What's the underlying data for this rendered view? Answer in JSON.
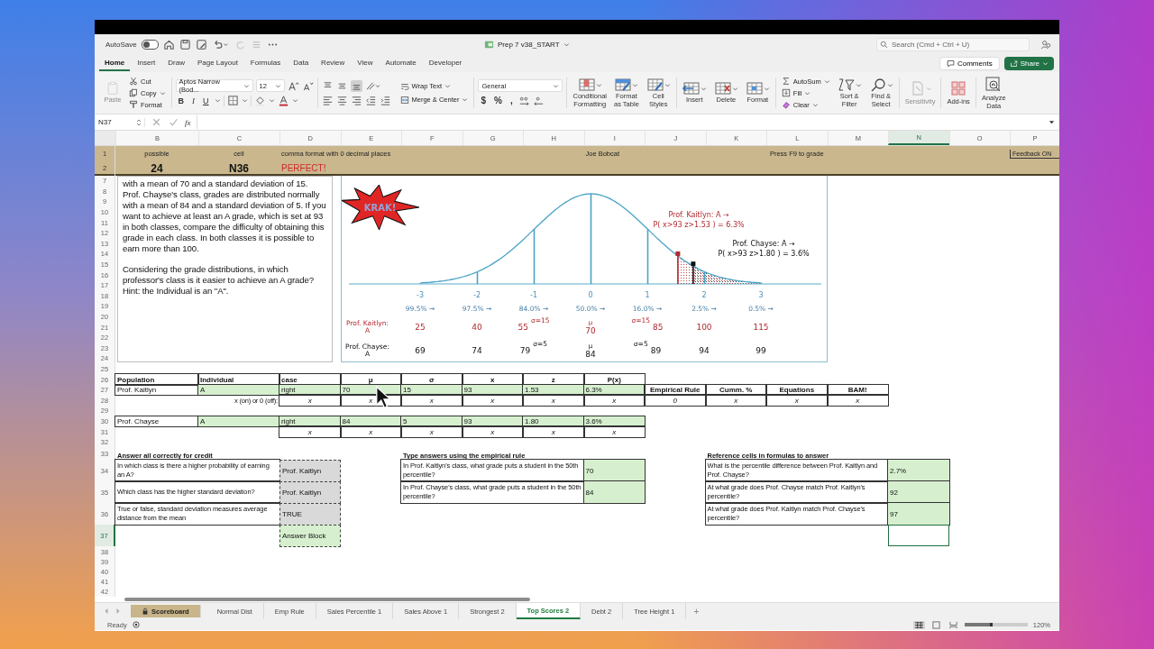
{
  "title_bar": {
    "autosave_label": "AutoSave",
    "autosave_on": false,
    "file_name": "Prep 7 v38_START",
    "search_placeholder": "Search (Cmd + Ctrl + U)"
  },
  "ribbon_tabs": [
    {
      "label": "Home",
      "selected": true
    },
    {
      "label": "Insert",
      "selected": false
    },
    {
      "label": "Draw",
      "selected": false
    },
    {
      "label": "Page Layout",
      "selected": false
    },
    {
      "label": "Formulas",
      "selected": false
    },
    {
      "label": "Data",
      "selected": false
    },
    {
      "label": "Review",
      "selected": false
    },
    {
      "label": "View",
      "selected": false
    },
    {
      "label": "Automate",
      "selected": false
    },
    {
      "label": "Developer",
      "selected": false
    }
  ],
  "comments_button": "Comments",
  "share_button": "Share",
  "ribbon": {
    "paste": {
      "label": "Paste",
      "disabled": true
    },
    "clipboard_items": [
      {
        "kind": "cut",
        "label": "Cut",
        "dropdown": false
      },
      {
        "kind": "copy",
        "label": "Copy",
        "dropdown": true
      },
      {
        "kind": "painter",
        "label": "Format",
        "dropdown": false
      }
    ],
    "font_name": "Aptos Narrow (Bod...",
    "font_size": "12",
    "style_buttons": [
      {
        "kind": "bold",
        "label": "B"
      },
      {
        "kind": "italic",
        "label": "I"
      },
      {
        "kind": "underline",
        "label": "U"
      }
    ],
    "vertical_align": [
      {
        "kind": "top",
        "selected": false
      },
      {
        "kind": "middle",
        "selected": false
      },
      {
        "kind": "bottom",
        "selected": true
      }
    ],
    "wrap_text": "Wrap Text",
    "merge_center": "Merge & Center",
    "number_format": "General",
    "number_symbols": [
      "$",
      "%",
      ","
    ],
    "styles_buttons": [
      {
        "kind": "conditional",
        "label": "Conditional\nFormatting",
        "dropdown": true,
        "disabled": false
      },
      {
        "kind": "table",
        "label": "Format\nas Table",
        "dropdown": true,
        "disabled": false
      },
      {
        "kind": "cellstyles",
        "label": "Cell\nStyles",
        "dropdown": true,
        "disabled": false
      }
    ],
    "cells_buttons": [
      {
        "kind": "insert",
        "label": "Insert",
        "dropdown": true,
        "disabled": false
      },
      {
        "kind": "delete",
        "label": "Delete",
        "dropdown": true,
        "disabled": false
      },
      {
        "kind": "format",
        "label": "Format",
        "dropdown": true,
        "disabled": false
      }
    ],
    "editing_items": [
      {
        "kind": "sum",
        "label": "AutoSum"
      },
      {
        "kind": "fill",
        "label": "Fill"
      },
      {
        "kind": "clear",
        "label": "Clear"
      }
    ],
    "editing_buttons": [
      {
        "kind": "sort",
        "label": "Sort &\nFilter",
        "dropdown": true,
        "disabled": false
      },
      {
        "kind": "find",
        "label": "Find &\nSelect",
        "dropdown": true,
        "disabled": false
      }
    ],
    "extra_buttons": [
      {
        "kind": "sensitivity",
        "label": "Sensitivity",
        "dropdown": true,
        "disabled": true
      },
      {
        "kind": "addins",
        "label": "Add-ins",
        "dropdown": false,
        "disabled": false
      },
      {
        "kind": "analyze",
        "label": "Analyze\nData",
        "dropdown": false,
        "disabled": false
      }
    ]
  },
  "formula_bar": {
    "name_box": "N37",
    "function_label": "fx"
  },
  "column_headers": [
    {
      "label": "B",
      "selected": false
    },
    {
      "label": "C",
      "selected": false
    },
    {
      "label": "D",
      "selected": false
    },
    {
      "label": "E",
      "selected": false
    },
    {
      "label": "F",
      "selected": false
    },
    {
      "label": "G",
      "selected": false
    },
    {
      "label": "H",
      "selected": false
    },
    {
      "label": "I",
      "selected": false
    },
    {
      "label": "J",
      "selected": false
    },
    {
      "label": "K",
      "selected": false
    },
    {
      "label": "L",
      "selected": false
    },
    {
      "label": "M",
      "selected": false
    },
    {
      "label": "N",
      "selected": true
    },
    {
      "label": "O",
      "selected": false
    },
    {
      "label": "P",
      "selected": false
    }
  ],
  "row_headers": [
    {
      "label": "1",
      "selected": false
    },
    {
      "label": "2",
      "selected": false
    },
    {
      "label": "7",
      "selected": false
    },
    {
      "label": "8",
      "selected": false
    },
    {
      "label": "9",
      "selected": false
    },
    {
      "label": "10",
      "selected": false
    },
    {
      "label": "11",
      "selected": false
    },
    {
      "label": "12",
      "selected": false
    },
    {
      "label": "13",
      "selected": false
    },
    {
      "label": "14",
      "selected": false
    },
    {
      "label": "15",
      "selected": false
    },
    {
      "label": "16",
      "selected": false
    },
    {
      "label": "17",
      "selected": false
    },
    {
      "label": "18",
      "selected": false
    },
    {
      "label": "19",
      "selected": false
    },
    {
      "label": "20",
      "selected": false
    },
    {
      "label": "21",
      "selected": false
    },
    {
      "label": "22",
      "selected": false
    },
    {
      "label": "23",
      "selected": false
    },
    {
      "label": "24",
      "selected": false
    },
    {
      "label": "25",
      "selected": false
    },
    {
      "label": "26",
      "selected": false
    },
    {
      "label": "27",
      "selected": false
    },
    {
      "label": "28",
      "selected": false
    },
    {
      "label": "29",
      "selected": false
    },
    {
      "label": "30",
      "selected": false
    },
    {
      "label": "31",
      "selected": false
    },
    {
      "label": "32",
      "selected": false
    },
    {
      "label": "33",
      "selected": false
    },
    {
      "label": "34",
      "selected": false
    },
    {
      "label": "35",
      "selected": false
    },
    {
      "label": "36",
      "selected": false
    },
    {
      "label": "37",
      "selected": true
    },
    {
      "label": "38",
      "selected": false
    },
    {
      "label": "39",
      "selected": false
    },
    {
      "label": "40",
      "selected": false
    },
    {
      "label": "41",
      "selected": false
    },
    {
      "label": "42",
      "selected": false
    }
  ],
  "banner": {
    "possible_label": "possible",
    "possible_value": "24",
    "cell_label": "cell",
    "cell_value": "N36",
    "note": "comma format with 0 decimal places",
    "status": "PERFECT!",
    "student": "Joe Bobcat",
    "instruction": "Press F9 to grade",
    "feedback": "Feedback ON"
  },
  "problem_text": [
    "with a mean of 70 and a standard deviation of 15. Prof. Chayse's class, grades are distributed normally with a mean of 84 and a standard deviation of 5. If you want to achieve at least an A grade, which is set at 93 in both classes, compare the difficulty of obtaining this grade in each class. In both classes it is possible to earn more than 100.",
    "Considering the grade distributions, in which professor's class is it easier to achieve an A grade? Hint: the Individual is an \"A\"."
  ],
  "distribution_chart": {
    "callout": "KRAK!",
    "annotations": [
      {
        "lines": [
          "Prof. Kaitlyn: A →",
          "P( x>93 z>1.53 ) = 6.3%"
        ],
        "kind": "highlight"
      },
      {
        "lines": [
          "Prof. Chayse: A →",
          "P( x>93 z>1.80 ) = 3.6%"
        ],
        "kind": "plain"
      }
    ],
    "z_labels": [
      "-3",
      "-2",
      "-1",
      "0",
      "1",
      "2",
      "3"
    ],
    "percent_labels": [
      "99.5% →",
      "97.5% →",
      "84.0% →",
      "50.0% →",
      "16.0% →",
      "2.5% →",
      "0.5% →"
    ],
    "grade_rows": [
      {
        "label": "Prof. Kaitlyn: A",
        "values": [
          {
            "value": "25"
          },
          {
            "value": "40"
          },
          {
            "value": "55",
            "note_right": "σ=15"
          },
          {
            "value": "70",
            "above": "μ"
          },
          {
            "value": "85",
            "note_left": "σ=15"
          },
          {
            "value": "100"
          },
          {
            "value": "115"
          }
        ]
      },
      {
        "label": "Prof. Chayse: A",
        "values": [
          {
            "value": "69"
          },
          {
            "value": "74"
          },
          {
            "value": "79",
            "note_right": "σ=5"
          },
          {
            "value": "84",
            "above": "μ"
          },
          {
            "value": "89",
            "note_left": "σ=5"
          },
          {
            "value": "94"
          },
          {
            "value": "99"
          }
        ]
      }
    ]
  },
  "calc_table": {
    "headers": [
      "Population",
      "Individual",
      "case",
      "μ",
      "σ",
      "x",
      "z",
      "P(x)"
    ],
    "rows": [
      {
        "cells": [
          "Prof. Kaitlyn",
          "A",
          "right",
          "70",
          "15",
          "93",
          "1.53",
          "6.3%"
        ],
        "toggle_label": "x (on) or 0 (off):",
        "toggles": [
          "x",
          "x",
          "x",
          "x",
          "x",
          "x"
        ]
      },
      {
        "cells": [
          "Prof. Chayse",
          "A",
          "right",
          "84",
          "5",
          "93",
          "1.80",
          "3.6%"
        ],
        "toggles": [
          "x",
          "x",
          "x",
          "x",
          "x",
          "x"
        ]
      }
    ],
    "options": [
      {
        "label": "Empirical Rule",
        "toggle": "0"
      },
      {
        "label": "Cumm. %",
        "toggle": "x"
      },
      {
        "label": "Equations",
        "toggle": "x"
      },
      {
        "label": "BAM!",
        "toggle": "x"
      }
    ]
  },
  "answer_section": {
    "title": "Answer all correctly for credit",
    "items": [
      {
        "question": "In which class is there a higher probability of earning an A?",
        "answer": "Prof. Kaitlyn"
      },
      {
        "question": "Which class has the higher standard deviation?",
        "answer": "Prof. Kaitlyn"
      },
      {
        "question": "True or false, standard deviation measures average distance from the mean",
        "answer": "TRUE"
      }
    ],
    "answer_block": "Answer Block"
  },
  "empirical_section": {
    "title": "Type answers using the empirical rule",
    "items": [
      {
        "question": "In Prof. Kaitlyn's class, what grade puts a student in the 50th percentile?",
        "answer": "70"
      },
      {
        "question": "In Prof. Chayse's class, what grade puts a student in the 50th percentile?",
        "answer": "84"
      }
    ]
  },
  "reference_section": {
    "title": "Reference cells in formulas to answer",
    "items": [
      {
        "question": "What is the percentile difference between Prof. Kaitlyn and Prof. Chayse?",
        "answer": "2.7%"
      },
      {
        "question": "At what grade does Prof. Chayse match Prof. Kaitlyn's percentile?",
        "answer": "92"
      },
      {
        "question": "At what grade does Prof. Kaitlyn match Prof. Chayse's percentile?",
        "answer": "97"
      }
    ]
  },
  "sheet_tabs": [
    {
      "label": "Scoreboard",
      "selected": false,
      "locked": true
    },
    {
      "label": "Normal Dist",
      "selected": false,
      "locked": false
    },
    {
      "label": "Emp Rule",
      "selected": false,
      "locked": false
    },
    {
      "label": "Sales Percentile 1",
      "selected": false,
      "locked": false
    },
    {
      "label": "Sales Above 1",
      "selected": false,
      "locked": false
    },
    {
      "label": "Strongest 2",
      "selected": false,
      "locked": false
    },
    {
      "label": "Top Scores 2",
      "selected": true,
      "locked": false
    },
    {
      "label": "Debt 2",
      "selected": false,
      "locked": false
    },
    {
      "label": "Tree Height 1",
      "selected": false,
      "locked": false
    }
  ],
  "add_sheet": "+",
  "status_bar": {
    "status": "Ready",
    "zoom_slider": {
      "level": 0.45
    },
    "zoom": "120%"
  }
}
